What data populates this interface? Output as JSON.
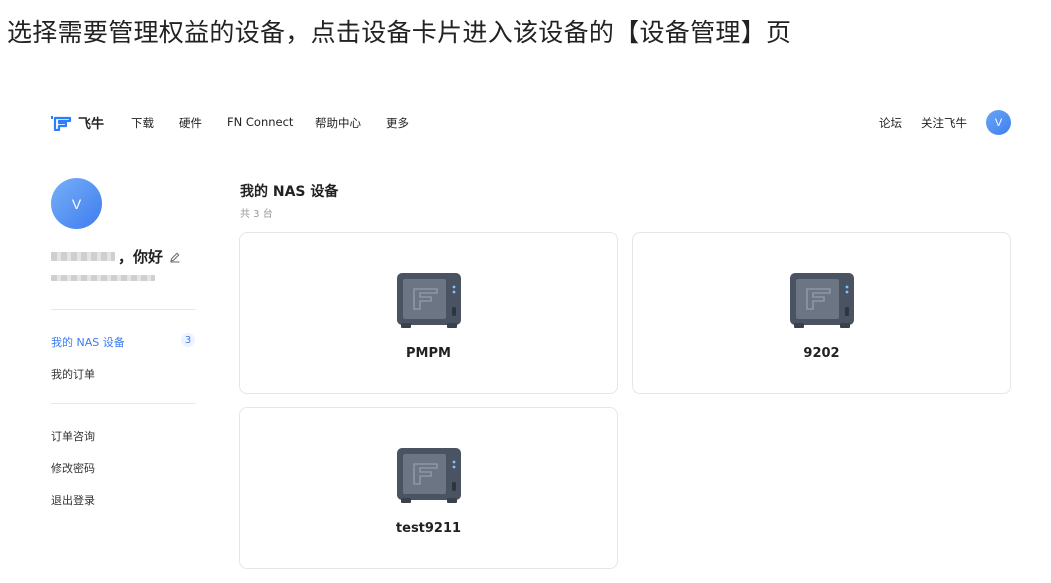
{
  "caption": "选择需要管理权益的设备，点击设备卡片进入该设备的【设备管理】页",
  "nav": {
    "brand": "飞牛",
    "items": [
      "下载",
      "硬件",
      "FN Connect",
      "帮助中心",
      "更多"
    ],
    "right": [
      "论坛",
      "关注飞牛"
    ],
    "avatar_letter": "V"
  },
  "sidebar": {
    "avatar_letter": "V",
    "greeting": "，你好",
    "menu_group1": [
      {
        "label": "我的 NAS 设备",
        "count": "3",
        "active": true
      },
      {
        "label": "我的订单"
      }
    ],
    "menu_group2": [
      {
        "label": "订单咨询"
      },
      {
        "label": "修改密码"
      },
      {
        "label": "退出登录"
      }
    ]
  },
  "main": {
    "title": "我的 NAS 设备",
    "subtitle": "共 3 台",
    "devices": [
      {
        "name": "PMPM"
      },
      {
        "name": "9202"
      },
      {
        "name": "test9211"
      }
    ]
  },
  "colors": {
    "accent": "#3b7cf0",
    "logo": "#2d7ff9",
    "nas_body": "#4a5361"
  }
}
